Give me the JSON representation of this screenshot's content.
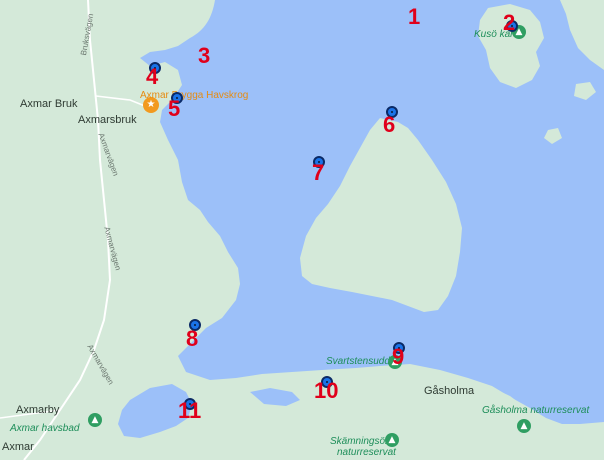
{
  "map": {
    "colors": {
      "water": "#9cc0f9",
      "land": "#d4e9d9",
      "road": "#ffffff",
      "marker": "#1a73e8",
      "number": "#e0001b"
    },
    "places": {
      "axmar_bruk": "Axmar Bruk",
      "axmarsbruk": "Axmarsbruk",
      "axmarby": "Axmarby",
      "axmar": "Axmar",
      "gasholma": "Gåsholma"
    },
    "pois": {
      "kuso_kalv": "Kusö kalv",
      "axmar_havskrog": "Axmar Brygga Havskrog",
      "svartstensudden": "Svartstensudden",
      "gasholma_reserve": "Gåsholma naturreservat",
      "skamningsons_line1": "Skämningsöns",
      "skamningsons_line2": "naturreservat",
      "axmar_havsbad": "Axmar havsbad"
    },
    "roads": {
      "bruksvagen": "Bruksvägen",
      "axmarvagen": "Axmarvägen",
      "axmarvagen2": "Axmarvägen",
      "axmarvag_sw": "Axmarvägen"
    },
    "icons": {
      "marker": "location-marker-icon",
      "park": "park-pin-icon",
      "restaurant": "restaurant-pin-icon"
    },
    "numbers": [
      "1",
      "2",
      "3",
      "4",
      "5",
      "6",
      "7",
      "8",
      "9",
      "10",
      "11"
    ]
  }
}
